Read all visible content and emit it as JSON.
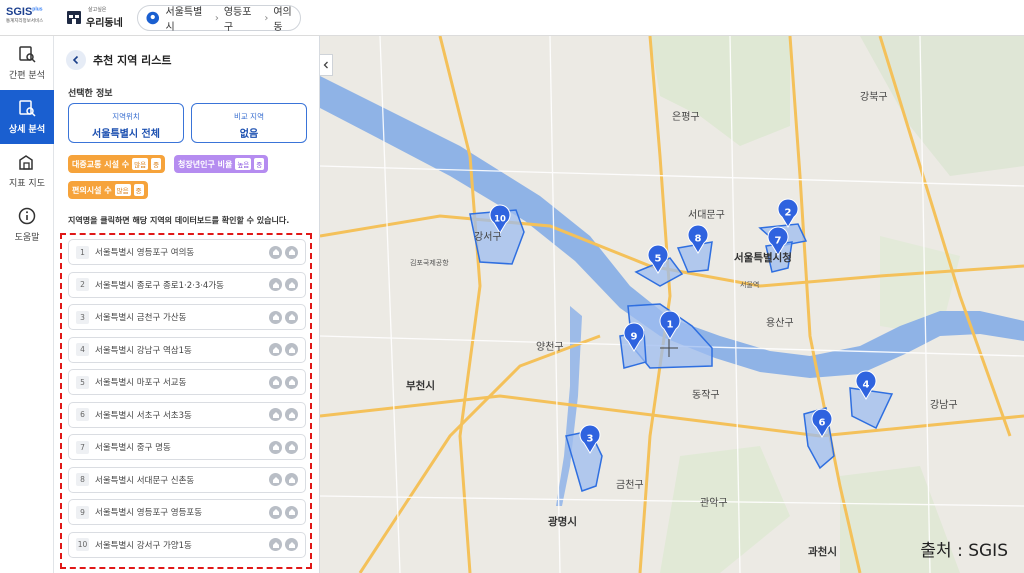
{
  "header": {
    "logo_text": "SGIS",
    "logo_sup": "plus",
    "logo_subtitle": "통계지리정보서비스",
    "brand_top": "살고싶은",
    "brand_name": "우리동네",
    "location": {
      "sido": "서울특별시",
      "sigungu": "영등포구",
      "dong": "여의동"
    }
  },
  "leftnav": [
    {
      "label": "간편 분석",
      "icon": "simple-analysis-icon"
    },
    {
      "label": "상세 분석",
      "icon": "detail-analysis-icon",
      "active": true
    },
    {
      "label": "지표 지도",
      "icon": "indicator-map-icon"
    },
    {
      "label": "도움말",
      "icon": "help-icon"
    }
  ],
  "panel": {
    "title": "추천 지역 리스트",
    "selected_label": "선택한 정보",
    "region_key": "지역위치",
    "region_value": "서울특별시 전체",
    "compare_key": "비교 지역",
    "compare_value": "없음",
    "chips": [
      {
        "text": "대중교통 시설 수",
        "tags": [
          "많음",
          "중"
        ],
        "color": "orange"
      },
      {
        "text": "청장년인구 비율",
        "tags": [
          "높음",
          "중"
        ],
        "color": "purple"
      },
      {
        "text": "편의시설 수",
        "tags": [
          "많음",
          "중"
        ],
        "color": "orange"
      }
    ],
    "hint": "지역명을 클릭하면 해당 지역의 데이터보드를 확인할 수 있습니다.",
    "items": [
      {
        "rank": "1",
        "name": "서울특별시 영등포구 여의동"
      },
      {
        "rank": "2",
        "name": "서울특별시 종로구 종로1·2·3·4가동"
      },
      {
        "rank": "3",
        "name": "서울특별시 금천구 가산동"
      },
      {
        "rank": "4",
        "name": "서울특별시 강남구 역삼1동"
      },
      {
        "rank": "5",
        "name": "서울특별시 마포구 서교동"
      },
      {
        "rank": "6",
        "name": "서울특별시 서초구 서초3동"
      },
      {
        "rank": "7",
        "name": "서울특별시 중구 명동"
      },
      {
        "rank": "8",
        "name": "서울특별시 서대문구 신촌동"
      },
      {
        "rank": "9",
        "name": "서울특별시 영등포구 영등포동"
      },
      {
        "rank": "10",
        "name": "서울특별시 강서구 가양1동"
      }
    ]
  },
  "map": {
    "labels": {
      "gangseo": "강서구",
      "bucheon": "부천시",
      "seoul": "서울특별시청",
      "gwangmyeong": "광명시",
      "gwacheon": "과천시",
      "eunpyeong": "은평구",
      "seodaemun": "서대문구",
      "yangcheon": "양천구",
      "geumcheon": "금천구",
      "yongsan": "용산구",
      "gangbuk": "강북구",
      "gimpo_airport": "김포국제공항",
      "seoul_station": "서울역",
      "gangnam": "강남구",
      "gwanak": "관악구",
      "dongjak": "동작구"
    },
    "markers": [
      "1",
      "2",
      "3",
      "4",
      "5",
      "6",
      "7",
      "8",
      "9",
      "10"
    ],
    "source_text": "출처 : SGIS",
    "colors": {
      "water": "#8fb3e6",
      "region_fill": "#9dbcf0",
      "region_stroke": "#2f6fe0",
      "marker": "#2f63df"
    }
  }
}
